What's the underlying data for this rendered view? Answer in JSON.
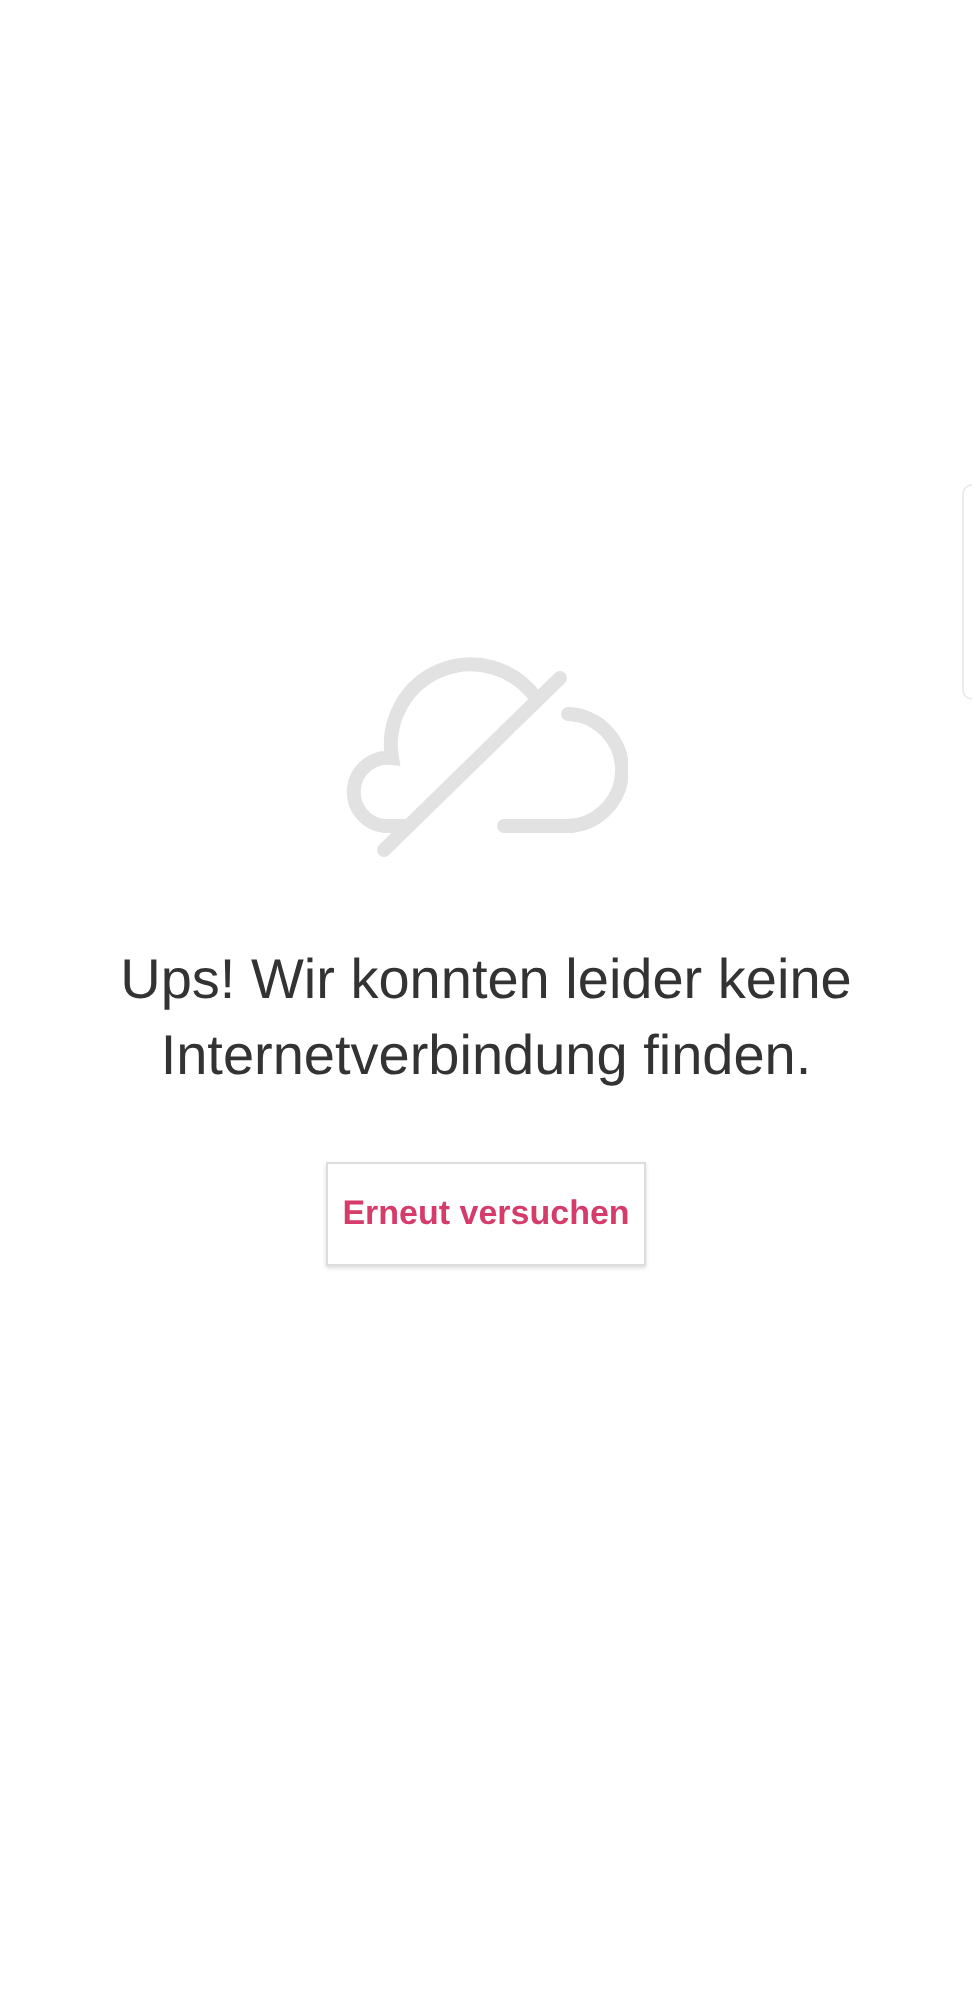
{
  "error": {
    "message": "Ups! Wir konnten leider keine Internetverbindung finden."
  },
  "retry_button": {
    "label": "Erneut versuchen"
  }
}
